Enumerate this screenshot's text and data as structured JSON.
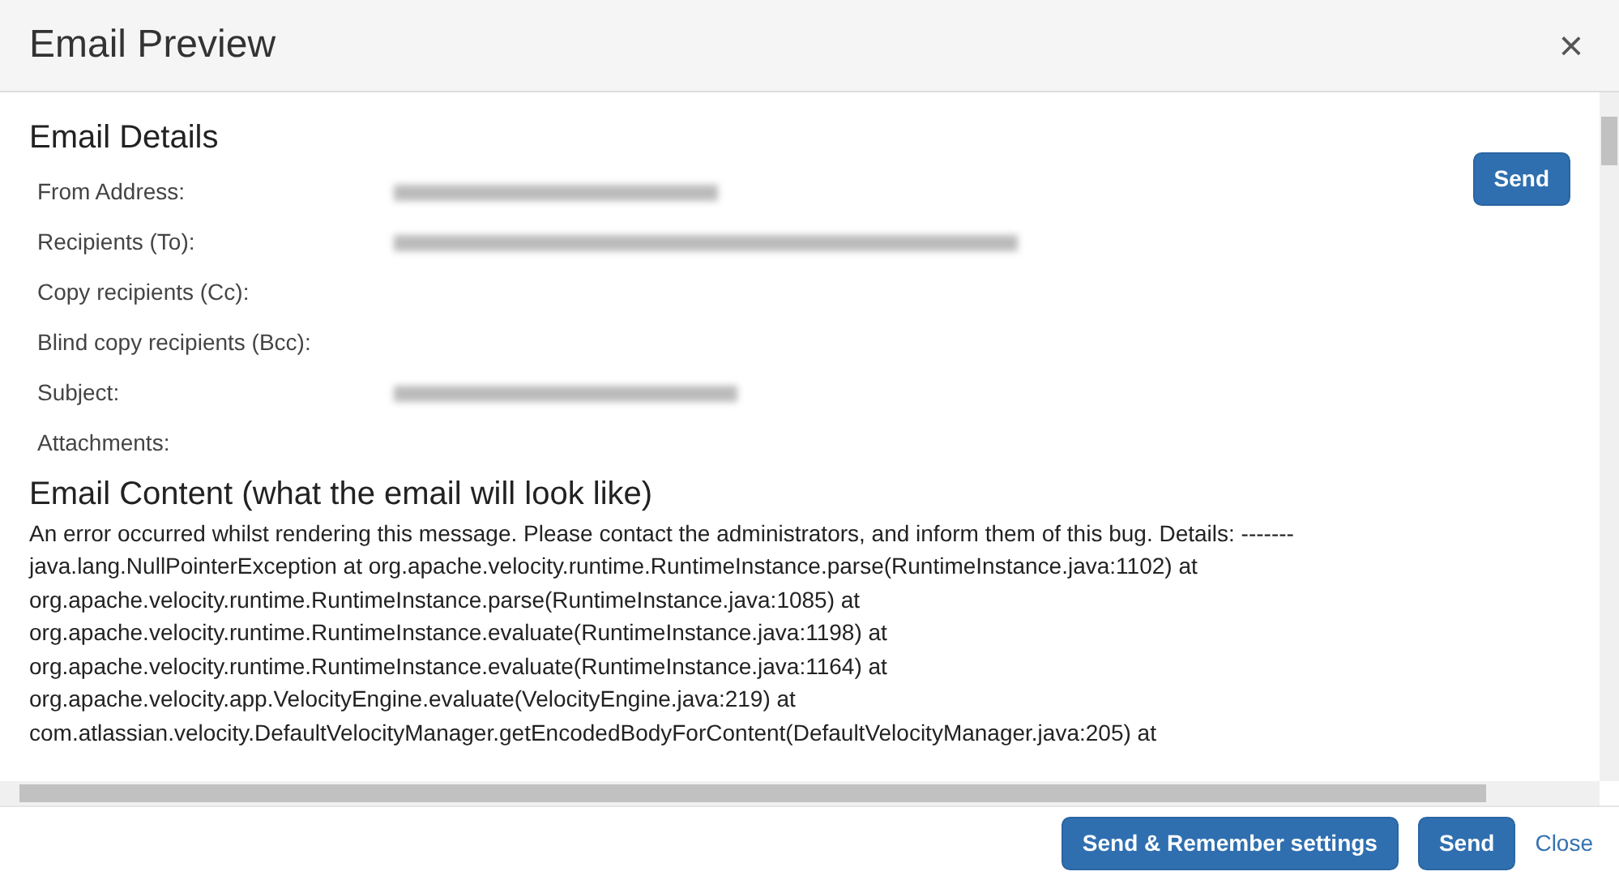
{
  "dialog": {
    "title": "Email Preview",
    "close_icon": "×"
  },
  "details": {
    "heading": "Email Details",
    "send_button": "Send",
    "rows": [
      {
        "label": "From Address:",
        "redacted": true
      },
      {
        "label": "Recipients (To):",
        "redacted": true
      },
      {
        "label": "Copy recipients (Cc):",
        "redacted": false
      },
      {
        "label": "Blind copy recipients (Bcc):",
        "redacted": false
      },
      {
        "label": "Subject:",
        "redacted": true
      },
      {
        "label": "Attachments:",
        "redacted": false
      }
    ]
  },
  "content": {
    "heading": "Email Content (what the email will look like)",
    "lines": [
      "An error occurred whilst rendering this message. Please contact the administrators, and inform them of this bug. Details: -------",
      "java.lang.NullPointerException at org.apache.velocity.runtime.RuntimeInstance.parse(RuntimeInstance.java:1102) at",
      "org.apache.velocity.runtime.RuntimeInstance.parse(RuntimeInstance.java:1085) at",
      "org.apache.velocity.runtime.RuntimeInstance.evaluate(RuntimeInstance.java:1198) at",
      "org.apache.velocity.runtime.RuntimeInstance.evaluate(RuntimeInstance.java:1164) at",
      "org.apache.velocity.app.VelocityEngine.evaluate(VelocityEngine.java:219) at",
      "com.atlassian.velocity.DefaultVelocityManager.getEncodedBodyForContent(DefaultVelocityManager.java:205) at"
    ]
  },
  "footer": {
    "buttons": [
      {
        "label": "Send & Remember settings",
        "kind": "primary"
      },
      {
        "label": "Send",
        "kind": "primary"
      },
      {
        "label": "Close",
        "kind": "link"
      }
    ]
  }
}
